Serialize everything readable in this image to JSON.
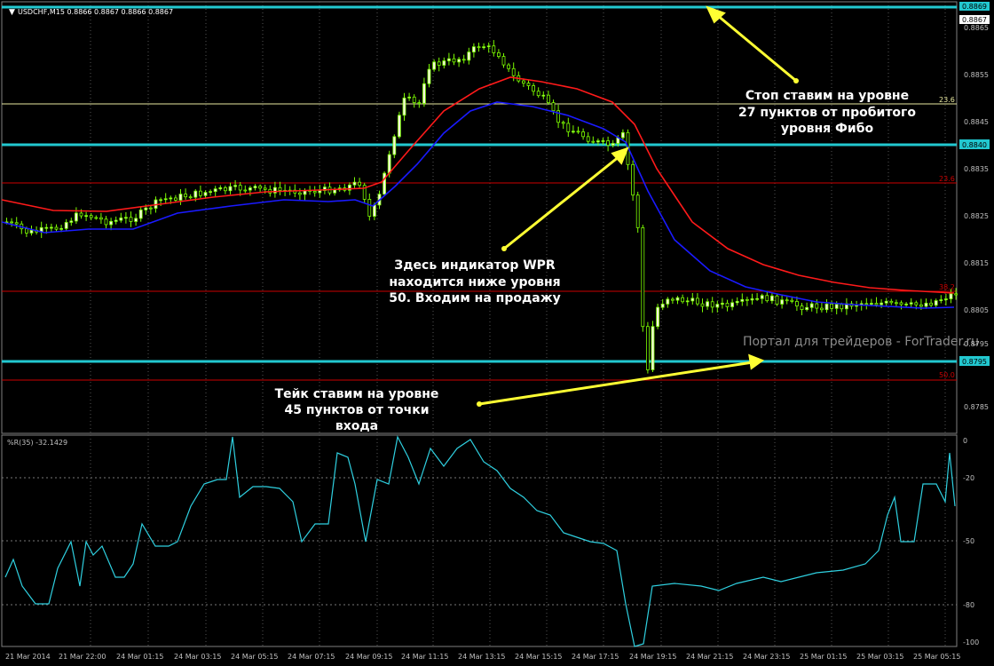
{
  "header": {
    "symbol_info": "USDCHF,M15  0.8866 0.8867 0.8866 0.8867"
  },
  "price_axis": {
    "labels": [
      "0.8865",
      "0.8855",
      "0.8845",
      "0.8835",
      "0.8825",
      "0.8815",
      "0.8805",
      "0.8795",
      "0.8785"
    ],
    "current_price": "0.8867",
    "top_price": "0.8869",
    "level_box_1": "0.8840",
    "level_box_2": "0.8795"
  },
  "fibo_levels": {
    "f1": "23.6",
    "f2": "23.6",
    "f3": "38.2",
    "f4": "50.0"
  },
  "annotations": {
    "stop_line1": "Стоп ставим на уровне",
    "stop_line2": "27 пунктов от пробитого",
    "stop_line3": "уровня Фибо",
    "entry_line1": "Здесь индикатор WPR",
    "entry_line2": "находится ниже уровня",
    "entry_line3": "50. Входим на продажу",
    "take_line1": "Тейк ставим на уровне",
    "take_line2": "45 пунктов от точки",
    "take_line3": "входа",
    "watermark": "Портал для трейдеров - ForTrader.ru"
  },
  "indicator": {
    "label": "%R(35) -32.1429",
    "levels": [
      "0",
      "-20",
      "-50",
      "-80",
      "-100"
    ]
  },
  "time_axis": [
    "21 Mar 2014",
    "21 Mar 22:00",
    "24 Mar 01:15",
    "24 Mar 03:15",
    "24 Mar 05:15",
    "24 Mar 07:15",
    "24 Mar 09:15",
    "24 Mar 11:15",
    "24 Mar 13:15",
    "24 Mar 15:15",
    "24 Mar 17:15",
    "24 Mar 19:15",
    "24 Mar 21:15",
    "24 Mar 23:15",
    "25 Mar 01:15",
    "25 Mar 03:15",
    "25 Mar 05:15"
  ],
  "colors": {
    "background": "#000000",
    "bull_candle": "#f5f5dc",
    "wick": "#7cfc00",
    "ma_fast": "#1a1aff",
    "ma_slow": "#ff1a1a",
    "level_line": "#22c8d0",
    "fibo_line": "#cc0000",
    "wpr_line": "#2fd0e0",
    "arrow": "#ffff33",
    "annotation_text": "#ffffff",
    "axis_text": "#c0c0c0"
  }
}
